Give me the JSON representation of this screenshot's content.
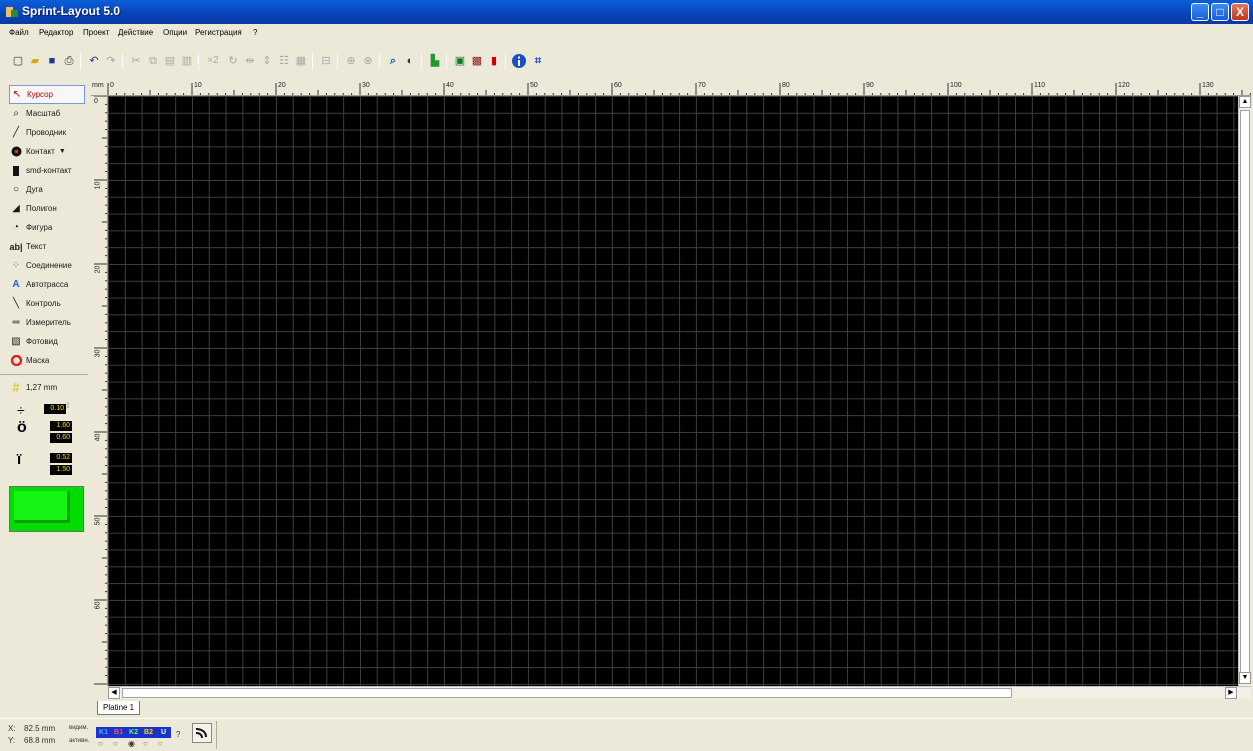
{
  "window": {
    "title": "Sprint-Layout 5.0",
    "controls": {
      "minimize": "_",
      "maximize": "□",
      "close": "X"
    }
  },
  "menu": [
    "Файл",
    "Редактор",
    "Проект",
    "Действие",
    "Опции",
    "Регистрация",
    "?"
  ],
  "toolbar": {
    "zoom_label": "×2",
    "icons": [
      "new-file-icon",
      "open-folder-icon",
      "save-icon",
      "print-icon",
      "undo-icon",
      "redo-icon",
      "cut-icon",
      "copy-icon",
      "paste-icon",
      "delete-icon",
      "duplicate-x2-icon",
      "rotate-icon",
      "mirror-horizontal-icon",
      "mirror-vertical-icon",
      "align-icon",
      "group-icon",
      "ungroup-icon",
      "lock-icon",
      "unlock-icon",
      "zoom-icon",
      "transparency-icon",
      "drc-icon",
      "scanned-copy-icon",
      "macro-icon",
      "component-icon",
      "info-icon",
      "crop-icon"
    ]
  },
  "tools": [
    {
      "label": "Курсор",
      "icon": "cursor-icon",
      "active": true
    },
    {
      "label": "Масштаб",
      "icon": "magnifier-icon",
      "active": false
    },
    {
      "label": "Проводник",
      "icon": "track-icon",
      "active": false
    },
    {
      "label": "Контакт",
      "icon": "pad-icon",
      "active": false
    },
    {
      "label": "smd-контакт",
      "icon": "smd-pad-icon",
      "active": false
    },
    {
      "label": "Дуга",
      "icon": "arc-icon",
      "active": false
    },
    {
      "label": "Полигон",
      "icon": "polygon-icon",
      "active": false
    },
    {
      "label": "Фигура",
      "icon": "shape-icon",
      "active": false
    },
    {
      "label": "Текст",
      "icon": "text-icon",
      "active": false
    },
    {
      "label": "Соединение",
      "icon": "connection-icon",
      "active": false
    },
    {
      "label": "Автотрасса",
      "icon": "autoroute-icon",
      "active": false
    },
    {
      "label": "Контроль",
      "icon": "test-icon",
      "active": false
    },
    {
      "label": "Измеритель",
      "icon": "measure-icon",
      "active": false
    },
    {
      "label": "Фотовид",
      "icon": "photoview-icon",
      "active": false
    },
    {
      "label": "Маска",
      "icon": "mask-icon",
      "active": false
    }
  ],
  "grid": {
    "label": "1,27 mm"
  },
  "widths": {
    "track": "0.10",
    "pad_outer": "1.60",
    "pad_inner": "0.60",
    "smd_width": "0.52",
    "smd_height": "1.50"
  },
  "ruler": {
    "unit": "mm",
    "h_labels": [
      "0",
      "10",
      "20",
      "30",
      "40",
      "50",
      "60",
      "70",
      "80",
      "90",
      "100",
      "110",
      "120",
      "130"
    ],
    "v_labels": [
      "0",
      "10",
      "20",
      "30",
      "40",
      "50",
      "60"
    ]
  },
  "tabs": [
    {
      "label": "Platine 1"
    }
  ],
  "status": {
    "x_label": "X:",
    "x_value": "82.5 mm",
    "y_label": "Y:",
    "y_value": "68.8 mm",
    "visible_label": "видим.",
    "active_label": "активн.",
    "question": "?",
    "layers": [
      "K1",
      "B1",
      "K2",
      "B2",
      "U"
    ]
  },
  "colors": {
    "canvas": "#000000",
    "grid": "#3f3f3f",
    "board_preview": "#00dd00",
    "value_box_text": "#ffd800"
  }
}
